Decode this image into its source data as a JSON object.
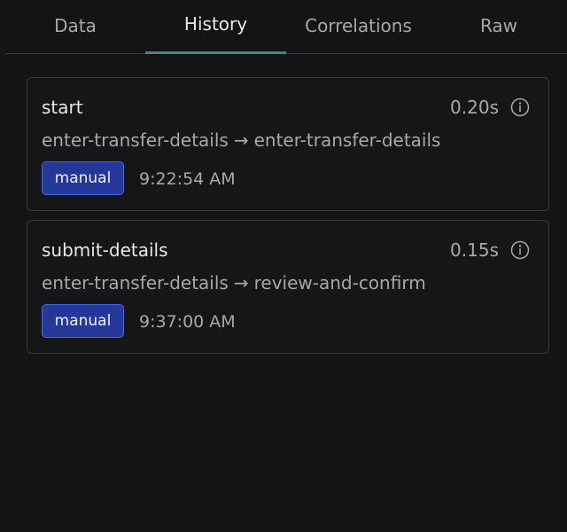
{
  "tabs": [
    {
      "label": "Data",
      "active": false
    },
    {
      "label": "History",
      "active": true
    },
    {
      "label": "Correlations",
      "active": false
    },
    {
      "label": "Raw",
      "active": false
    }
  ],
  "history": [
    {
      "event": "start",
      "duration": "0.20s",
      "from": "enter-transfer-details",
      "arrow": "→",
      "to": "enter-transfer-details",
      "trigger": "manual",
      "time": "9:22:54 AM"
    },
    {
      "event": "submit-details",
      "duration": "0.15s",
      "from": "enter-transfer-details",
      "arrow": "→",
      "to": "review-and-confirm",
      "trigger": "manual",
      "time": "9:37:00 AM"
    }
  ],
  "icons": {
    "info": "info-icon"
  },
  "colors": {
    "background": "#131416",
    "accent_underline": "#4b7d93",
    "badge_fill": "#24389a",
    "badge_border": "#4a66e0"
  }
}
